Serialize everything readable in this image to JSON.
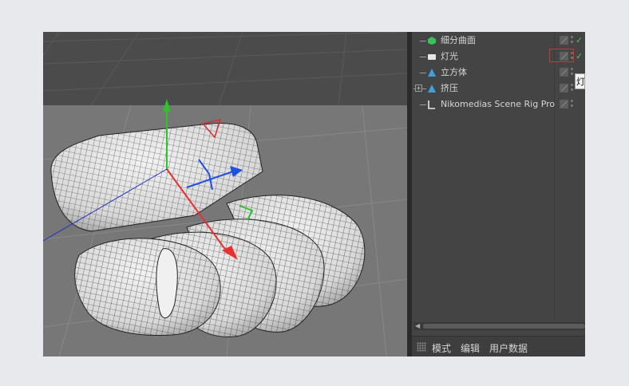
{
  "objects": [
    {
      "name": "细分曲面",
      "icon": "subdivision-surface-icon",
      "color": "#3fbf5a",
      "check": "✓"
    },
    {
      "name": "灯光",
      "icon": "light-icon",
      "color": "#e6e6e6",
      "check": "✓"
    },
    {
      "name": "立方体",
      "icon": "cube-icon",
      "color": "#3fa0e0",
      "check": ""
    },
    {
      "name": "挤压",
      "icon": "extrude-icon",
      "color": "#3fa0e0",
      "check": ""
    },
    {
      "name": "Nikomedias Scene Rig Pro",
      "icon": "null-object-icon",
      "color": "#e6e6e6",
      "check": ""
    }
  ],
  "tooltip": "灯",
  "bottom_menu": [
    "模式",
    "编辑",
    "用户数据"
  ],
  "colors": {
    "x_axis": "#e83030",
    "y_axis": "#30c030",
    "z_axis": "#2050e0",
    "highlight_box": "#d43333"
  }
}
